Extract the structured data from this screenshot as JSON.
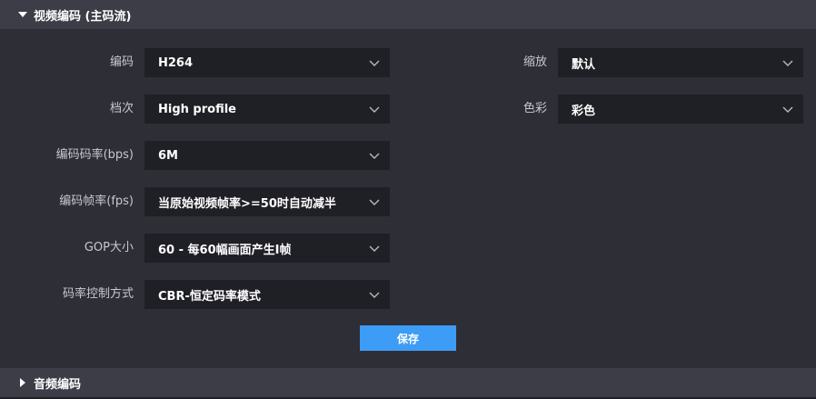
{
  "video_section": {
    "title": "视频编码 (主码流)",
    "expanded": true
  },
  "audio_section": {
    "title": "音频编码",
    "expanded": false
  },
  "fields": {
    "encoding": {
      "label": "编码",
      "value": "H264"
    },
    "profile": {
      "label": "档次",
      "value": "High profile"
    },
    "bitrate": {
      "label": "编码码率(bps)",
      "value": "6M"
    },
    "framerate": {
      "label": "编码帧率(fps)",
      "value": "当原始视频帧率>=50时自动减半"
    },
    "gop": {
      "label": "GOP大小",
      "value": "60 - 每60幅画面产生I帧"
    },
    "rate_control": {
      "label": "码率控制方式",
      "value": "CBR-恒定码率模式"
    },
    "scale": {
      "label": "缩放",
      "value": "默认"
    },
    "color": {
      "label": "色彩",
      "value": "彩色"
    }
  },
  "save_label": "保存",
  "colors": {
    "background": "#2e2e36",
    "header": "#3d3d47",
    "select_bg": "#1f1f26",
    "accent": "#3d9cf5"
  },
  "icons": {
    "expand": "caret-down-icon",
    "collapse": "caret-right-icon",
    "dropdown": "chevron-down-icon"
  }
}
